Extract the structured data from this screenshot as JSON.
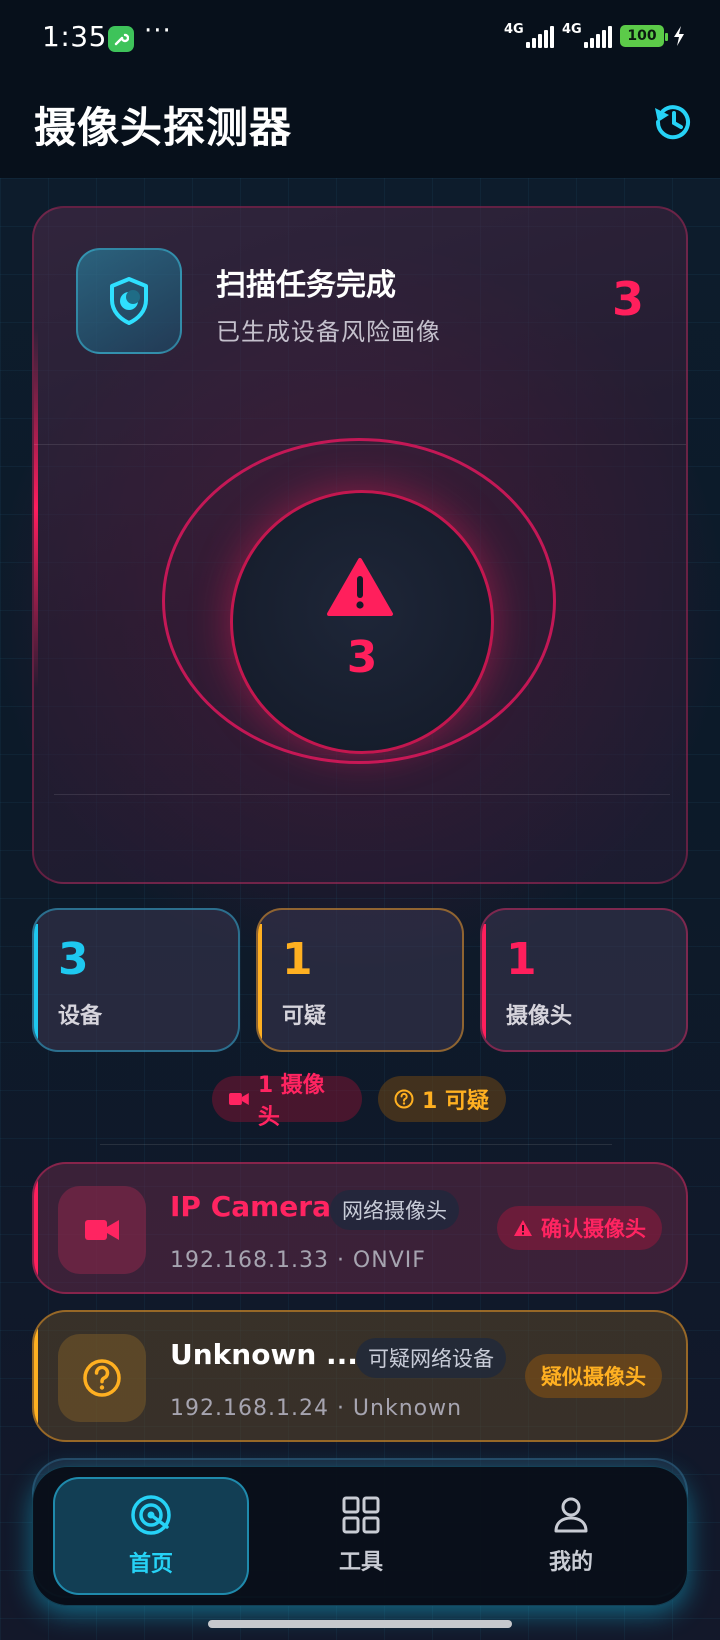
{
  "status_bar": {
    "time": "1:35",
    "dots": "···",
    "sim1": "4G",
    "sim2": "4G",
    "battery": "100"
  },
  "header": {
    "title": "摄像头探测器",
    "history_icon": "history-icon"
  },
  "scan_card": {
    "title": "扫描任务完成",
    "subtitle": "已生成设备风险画像",
    "count": "3",
    "center_count": "3",
    "icons": [
      "shield-icon",
      "warning-icon"
    ]
  },
  "stats": [
    {
      "value": "3",
      "label": "设备",
      "color": "#1ec8f0"
    },
    {
      "value": "1",
      "label": "可疑",
      "color": "#ffb021"
    },
    {
      "value": "1",
      "label": "摄像头",
      "color": "#ff1f5c"
    }
  ],
  "chips": {
    "camera": "1 摄像头",
    "suspicious": "1 可疑"
  },
  "devices": [
    {
      "name": "IP Camera",
      "tag": "网络摄像头",
      "meta": "192.168.1.33 · ONVIF",
      "badge": "确认摄像头",
      "color": "#ff2461",
      "icon": "video-camera-icon"
    },
    {
      "name": "Unknown ...",
      "tag": "可疑网络设备",
      "meta": "192.168.1.24 · Unknown",
      "badge": "疑似摄像头",
      "color": "#ffb021",
      "icon": "question-icon"
    }
  ],
  "nav": {
    "home": "首页",
    "tools": "工具",
    "me": "我的",
    "active": "home"
  },
  "colors": {
    "accent_cyan": "#26d2f6",
    "danger": "#ff1f5c",
    "warning": "#ffb021"
  }
}
